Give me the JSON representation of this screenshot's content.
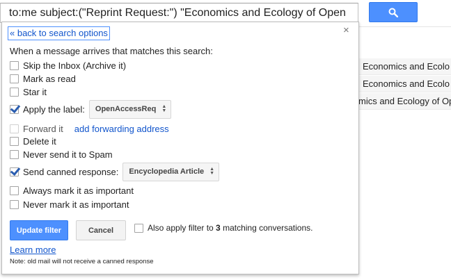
{
  "search": {
    "query": "to:me subject:(\"Reprint Request:\") \"Economics and Ecology of Open"
  },
  "icons": {
    "search_button": "search-icon",
    "close": "close-icon",
    "select_arrows": "up-down-arrows-icon"
  },
  "colors": {
    "accent_blue": "#4d90fe",
    "link_blue": "#1155cc",
    "check_blue": "#2a5db0"
  },
  "background_rows": [
    "Economics and Ecolo",
    "Economics and Ecolo",
    "mics and Ecology of Op"
  ],
  "dialog": {
    "back_link": "« back to search options",
    "close": "×",
    "intro": "When a message arrives that matches this search:",
    "options": {
      "skip_inbox": "Skip the Inbox (Archive it)",
      "mark_read": "Mark as read",
      "star_it": "Star it",
      "apply_label": "Apply the label:",
      "forward_it": "Forward it",
      "add_forwarding": "add forwarding address",
      "delete_it": "Delete it",
      "never_spam": "Never send it to Spam",
      "canned_response": "Send canned response:",
      "always_important": "Always mark it as important",
      "never_important": "Never mark it as important"
    },
    "label_select": "OpenAccessReq",
    "canned_select": "Encyclopedia Article",
    "update_button": "Update filter",
    "cancel_button": "Cancel",
    "apply_also_prefix": "Also apply filter to ",
    "apply_also_count": "3",
    "apply_also_suffix": " matching conversations.",
    "learn_more": "Learn more",
    "note": "Note: old mail will not receive a canned response"
  }
}
